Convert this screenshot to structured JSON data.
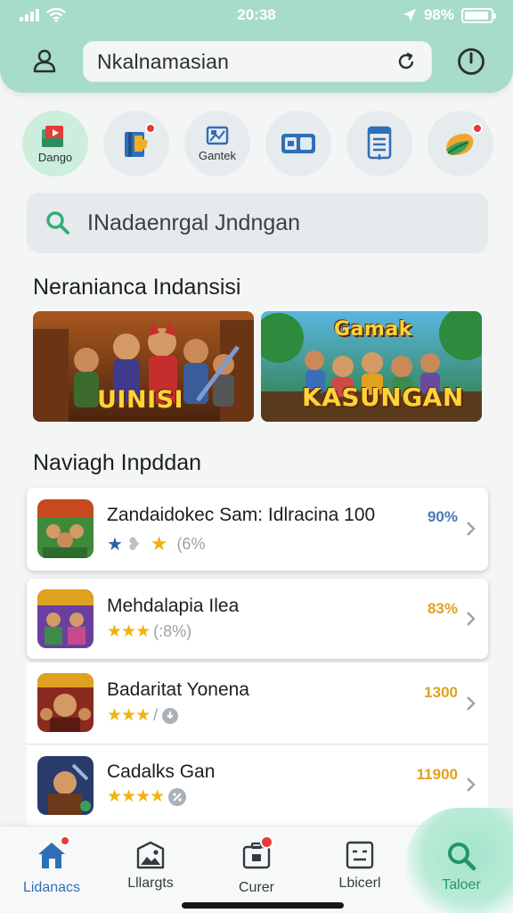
{
  "status_bar": {
    "time": "20:38",
    "battery": "98%"
  },
  "header": {
    "url": "Nkalnamasian"
  },
  "categories": [
    {
      "label": "Dango",
      "icon": "video-folder-icon",
      "active": true
    },
    {
      "label": "",
      "icon": "book-icon",
      "badge": true
    },
    {
      "label": "Gantek",
      "icon": "picture-frame-icon"
    },
    {
      "label": "",
      "icon": "cards-icon"
    },
    {
      "label": "",
      "icon": "document-list-icon"
    },
    {
      "label": "",
      "icon": "leaf-game-icon",
      "badge": true
    }
  ],
  "search": {
    "text": "INadaenrgal Jndngan"
  },
  "section1": {
    "title": "Neranianca Indansisi",
    "banners": [
      {
        "title": "UINISI"
      },
      {
        "title_top": "Gamak",
        "title": "KASUNGAN"
      }
    ]
  },
  "section2": {
    "title": "Naviagh Inpddan",
    "items": [
      {
        "title": "Zandaidokec Sam: Idlracina 100",
        "rating_text": "(6%",
        "value": "90%",
        "value_color": "#4a78b4"
      },
      {
        "title": "Mehdalapia Ilea",
        "stars": "★★★",
        "rating_text": "(:8%)",
        "value": "83%",
        "value_color": "#e0a020"
      },
      {
        "title": "Badaritat Yonena",
        "stars": "★★★",
        "rating_text": "/",
        "value": "1300",
        "value_color": "#e0a020"
      },
      {
        "title": "Cadalks Gan",
        "stars": "★★★★",
        "rating_text": "",
        "value": "11900",
        "value_color": "#e0a020"
      }
    ]
  },
  "bottom_nav": [
    {
      "label": "Lidanacs",
      "icon": "home-icon",
      "badge": true
    },
    {
      "label": "Lllargts",
      "icon": "image-icon"
    },
    {
      "label": "Curer",
      "icon": "briefcase-icon",
      "badge": true
    },
    {
      "label": "Lbicerl",
      "icon": "device-icon"
    },
    {
      "label": "Taloer",
      "icon": "search-icon"
    }
  ],
  "colors": {
    "accent": "#a7dcc8",
    "header": "#a7dcc8",
    "star": "#f0b20e",
    "badge": "#e83a3a"
  }
}
